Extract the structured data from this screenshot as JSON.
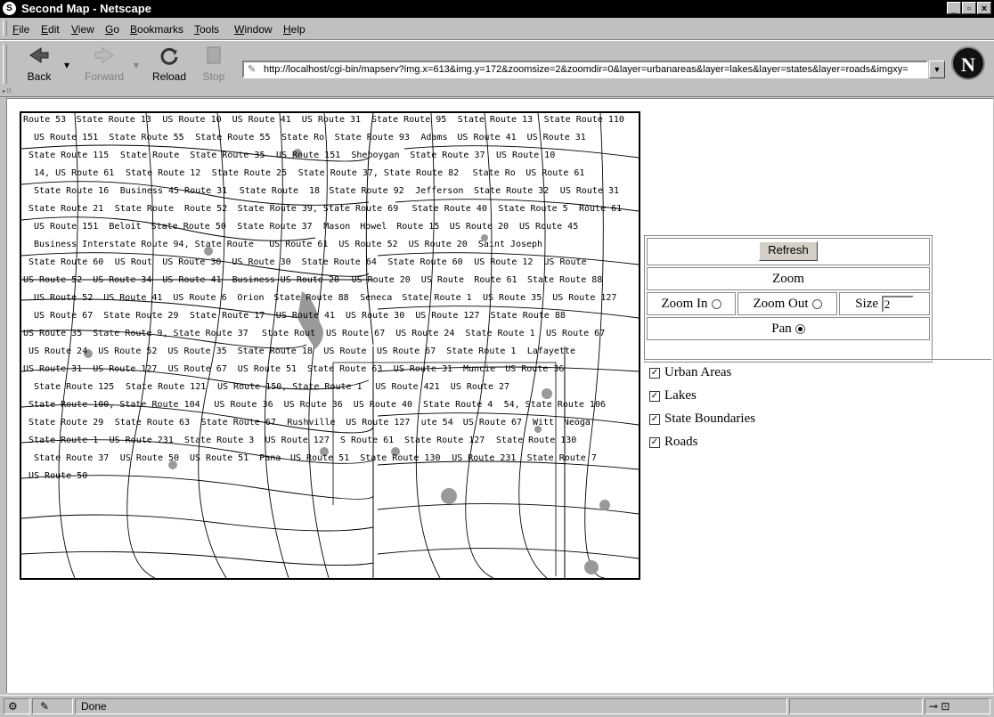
{
  "window": {
    "title": "Second Map - Netscape",
    "icon": "netscape-icon"
  },
  "menubar": [
    "File",
    "Edit",
    "View",
    "Go",
    "Bookmarks",
    "Tools",
    "Window",
    "Help"
  ],
  "toolbar": {
    "back": "Back",
    "forward": "Forward",
    "reload": "Reload",
    "stop": "Stop",
    "url": "http://localhost/cgi-bin/mapserv?img.x=613&img.y=172&zoomsize=2&zoomdir=0&layer=urbanareas&layer=lakes&layer=states&layer=roads&imgxy="
  },
  "controls": {
    "refresh_label": "Refresh",
    "zoom_heading": "Zoom",
    "zoom_in_label": "Zoom In",
    "zoom_out_label": "Zoom Out",
    "size_label": "Size",
    "size_value": "2",
    "pan_label": "Pan",
    "selected_mode": "pan"
  },
  "layers": [
    {
      "label": "Urban Areas",
      "checked": true
    },
    {
      "label": "Lakes",
      "checked": true
    },
    {
      "label": "State Boundaries",
      "checked": true
    },
    {
      "label": "Roads",
      "checked": true
    }
  ],
  "status": {
    "text": "Done"
  },
  "map": {
    "labels": [
      "Route 53",
      "State Route 13",
      "US Route 10",
      "US Route 41",
      "US Route 31",
      "State Route 95",
      "State Route 13",
      "State Route 110",
      "US Route 151",
      "State Route 55",
      "State Route 55",
      "State Ro",
      "State Route 93",
      "Adams",
      "US Route 41",
      "US Route 31",
      "State Route 115",
      "State Route",
      "State Route 35",
      "US Route 151",
      "Sheboygan",
      "State Route 37",
      "US Route 10",
      "14, US Route 61",
      "State Route 12",
      "State Route 25",
      "State Route 37, State Route 82",
      "State Ro",
      "US Route 61",
      "State Route 16",
      "Business 45 Route 31",
      "State Route",
      "18",
      "State Route 92",
      "Jefferson",
      "State Route 32",
      "US Route 31",
      "State Route 21",
      "State Route",
      "Route 52",
      "State Route 39, State Route 69",
      "State Route 40",
      "State Route 5",
      "Route 61",
      "US Route 151",
      "Beloit",
      "State Route 50",
      "State Route 37",
      "Mason",
      "Howel",
      "Route 15",
      "US Route 20",
      "US Route 45",
      "Business Interstate Route 94, State Route",
      "US Route 61",
      "US Route 52",
      "US Route 20",
      "Saint Joseph",
      "State Route 60",
      "US Rout",
      "US Route 30",
      "US Route 30",
      "State Route 64",
      "State Route 60",
      "US Route 12",
      "US Route",
      "US Route 52",
      "US Route 34",
      "US Route 41",
      "Business US Route 20",
      "US Route 20",
      "US Route",
      "Route 61",
      "State Route 88",
      "US Route 52",
      "US Route 41",
      "US Route 6",
      "Orion",
      "State Route 88",
      "Seneca",
      "State Route 1",
      "US Route 35",
      "US Route 127",
      "US Route 67",
      "State Route 29",
      "State Route 17",
      "US Route 41",
      "US Route 30",
      "US Route 127",
      "State Route 88",
      "US Route 35",
      "State Route 9, State Route 37",
      "State Rout",
      "US Route 67",
      "US Route 24",
      "State Route 1",
      "US Route 67",
      "US Route 24",
      "US Route 52",
      "US Route 35",
      "State Route 18",
      "US Route",
      "US Route 67",
      "State Route 1",
      "Lafayette",
      "US Route 31",
      "US Route 127",
      "US Route 67",
      "US Route 51",
      "State Route 63",
      "US Route 31",
      "Muncie",
      "US Route 36",
      "State Route 125",
      "State Route 121",
      "US Route 150, State Route 1",
      "US Route 421",
      "US Route 27",
      "State Route 100, State Route 104",
      "US Route 36",
      "US Route 36",
      "US Route 40",
      "State Route 4",
      "54, State Route 106",
      "State Route 29",
      "State Route 63",
      "State Route 67",
      "Rushville",
      "US Route 127",
      "ute 54",
      "US Route 67",
      "Witt",
      "Neoga",
      "State Route 1",
      "US Route 231",
      "State Route 3",
      "US Route 127",
      "S Route 61",
      "State Route 127",
      "State Route 130",
      "State Route 37",
      "US Route 50",
      "US Route 51",
      "Pana",
      "US Route 51",
      "State Route 130",
      "US Route 231",
      "State Route 7",
      "US Route 50"
    ]
  }
}
